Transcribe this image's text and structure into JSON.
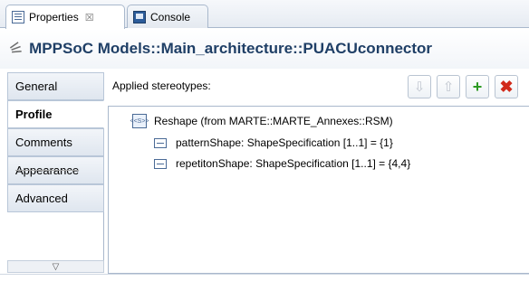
{
  "tabs": {
    "properties_label": "Properties",
    "properties_close": "☒",
    "console_label": "Console"
  },
  "title": "MPPSoC Models::Main_architecture::PUACUconnector",
  "sections": {
    "general": "General",
    "profile": "Profile",
    "comments": "Comments",
    "appearance": "Appearance",
    "advanced": "Advanced",
    "scroll_glyph": "▽"
  },
  "main": {
    "applied_label": "Applied stereotypes:",
    "buttons": {
      "down": "⇩",
      "up": "⇧",
      "add": "+",
      "delete": "✖"
    }
  },
  "tree": {
    "stereotype_badge": "<<S>>",
    "stereotype": "Reshape   (from MARTE::MARTE_Annexes::RSM)",
    "properties": [
      "patternShape: ShapeSpecification [1..1] = {1}",
      "repetitonShape: ShapeSpecification [1..1] = {4,4}"
    ]
  }
}
